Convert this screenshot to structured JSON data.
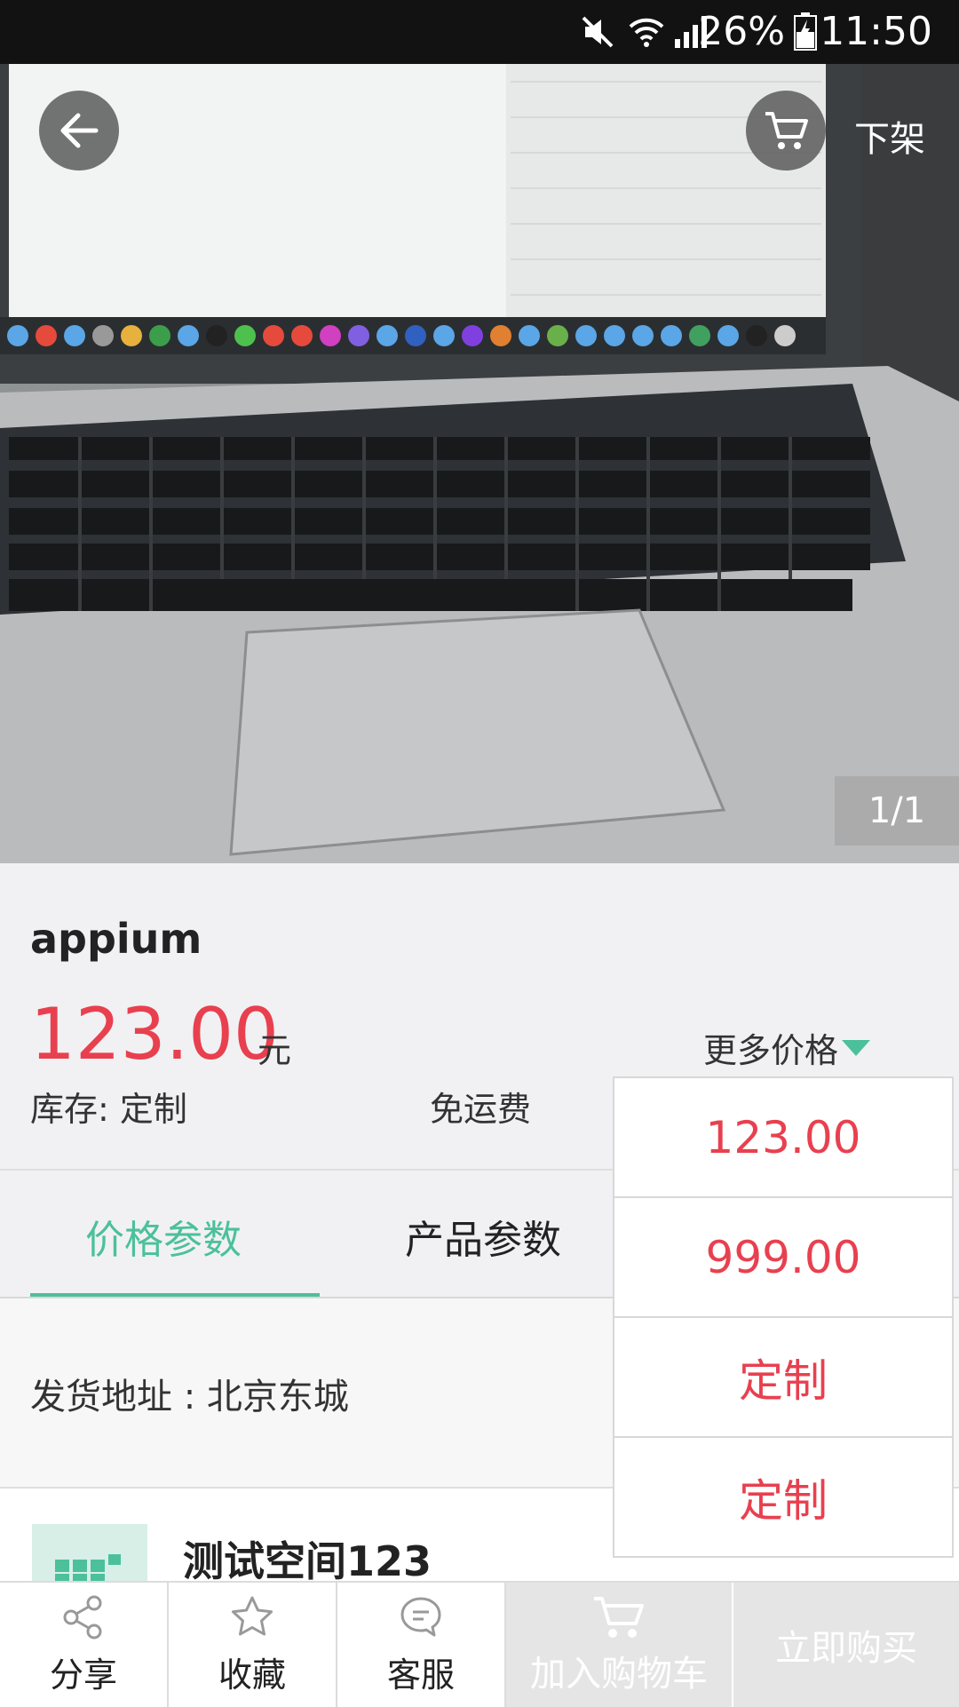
{
  "status_bar": {
    "battery_percent": "26%",
    "time": "11:50"
  },
  "header": {
    "off_shelf_label": "下架"
  },
  "gallery": {
    "counter": "1/1"
  },
  "product": {
    "name": "appium",
    "price": "123.00",
    "unit": "元",
    "more_price_label": "更多价格",
    "stock": "库存:  定制",
    "shipping": "免运费"
  },
  "price_dropdown": {
    "options": [
      "123.00",
      "999.00",
      "定制",
      "定制"
    ]
  },
  "tabs": [
    {
      "label": "价格参数",
      "active": true
    },
    {
      "label": "产品参数",
      "active": false
    }
  ],
  "shipping_address": "发货地址 : 北京东城",
  "store": {
    "name": "测试空间123"
  },
  "bottom_bar": {
    "share": "分享",
    "favorite": "收藏",
    "service": "客服",
    "add_to_cart": "加入购物车",
    "buy_now": "立即购买"
  },
  "colors": {
    "accent": "#4cc09b",
    "price": "#e8404f",
    "disabled": "#e5e5e5"
  }
}
